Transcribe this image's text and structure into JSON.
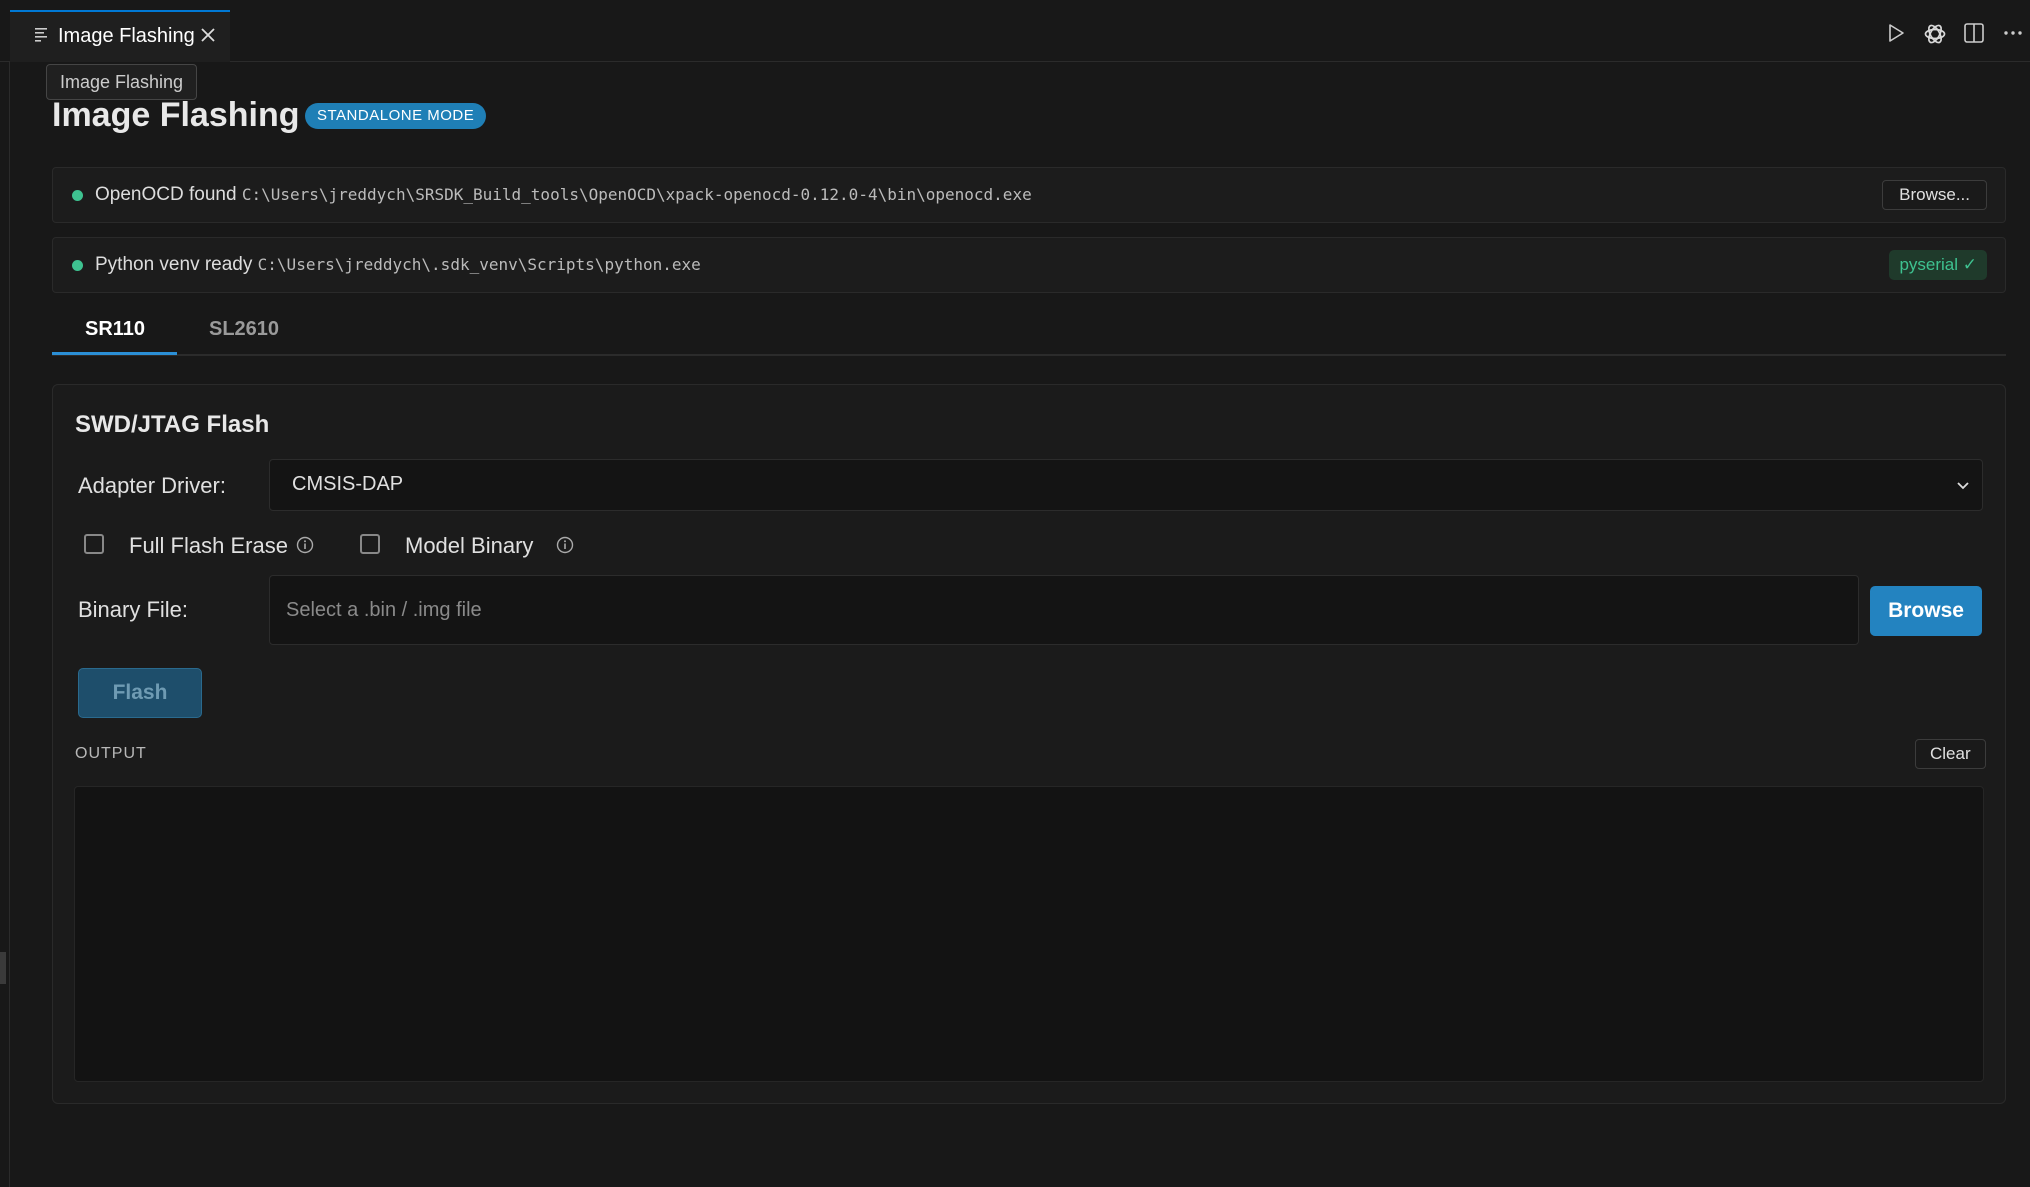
{
  "editor": {
    "tab_title": "Image Flashing",
    "tooltip": "Image Flashing",
    "actions": [
      "run-icon",
      "openai-icon",
      "split-editor-icon",
      "more-actions-icon"
    ]
  },
  "header": {
    "title": "Image Flashing",
    "badge": "STANDALONE MODE"
  },
  "status": {
    "openocd": {
      "label": "OpenOCD found",
      "path": "C:\\Users\\jreddych\\SRSDK_Build_tools\\OpenOCD\\xpack-openocd-0.12.0-4\\bin\\openocd.exe",
      "button": "Browse..."
    },
    "python": {
      "label": "Python venv ready",
      "path": "C:\\Users\\jreddych\\.sdk_venv\\Scripts\\python.exe",
      "badge": "pyserial ✓"
    }
  },
  "board_tabs": [
    {
      "label": "SR110",
      "active": true
    },
    {
      "label": "SL2610",
      "active": false
    }
  ],
  "panel": {
    "title": "SWD/JTAG Flash",
    "adapter": {
      "label": "Adapter Driver:",
      "value": "CMSIS-DAP"
    },
    "options": [
      {
        "label": "Full Flash Erase",
        "checked": false
      },
      {
        "label": "Model Binary",
        "checked": false
      }
    ],
    "binary": {
      "label": "Binary File:",
      "placeholder": "Select a .bin / .img file",
      "value": "",
      "browse": "Browse"
    },
    "flash_button": "Flash",
    "output": {
      "label": "OUTPUT",
      "clear": "Clear",
      "text": ""
    }
  },
  "colors": {
    "accent": "#0078d4",
    "badge": "#1f7fb6",
    "status_ok": "#3ec290",
    "browse_button": "#2383c0",
    "flash_button_disabled": "#1e4e6b"
  }
}
